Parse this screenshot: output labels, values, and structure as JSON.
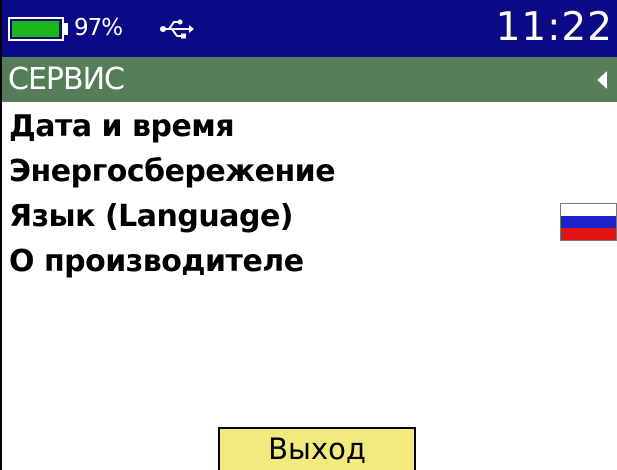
{
  "status_bar": {
    "battery_level": 0.97,
    "battery_percent": "97%",
    "usb_icon": "usb-icon",
    "time": "11:22"
  },
  "header": {
    "title": "СЕРВИС",
    "back_icon": "triangle-left-icon"
  },
  "menu": {
    "items": [
      {
        "label": "Дата и время"
      },
      {
        "label": "Энергосбережение"
      },
      {
        "label": "Язык (Language)",
        "indicator": "russian-flag-icon"
      },
      {
        "label": "О производителе"
      }
    ]
  },
  "footer": {
    "exit_label": "Выход"
  },
  "colors": {
    "status_bar": "#0a0a86",
    "header": "#557d57",
    "battery_fill": "#1db51d",
    "exit_button": "#f3ea7d"
  }
}
